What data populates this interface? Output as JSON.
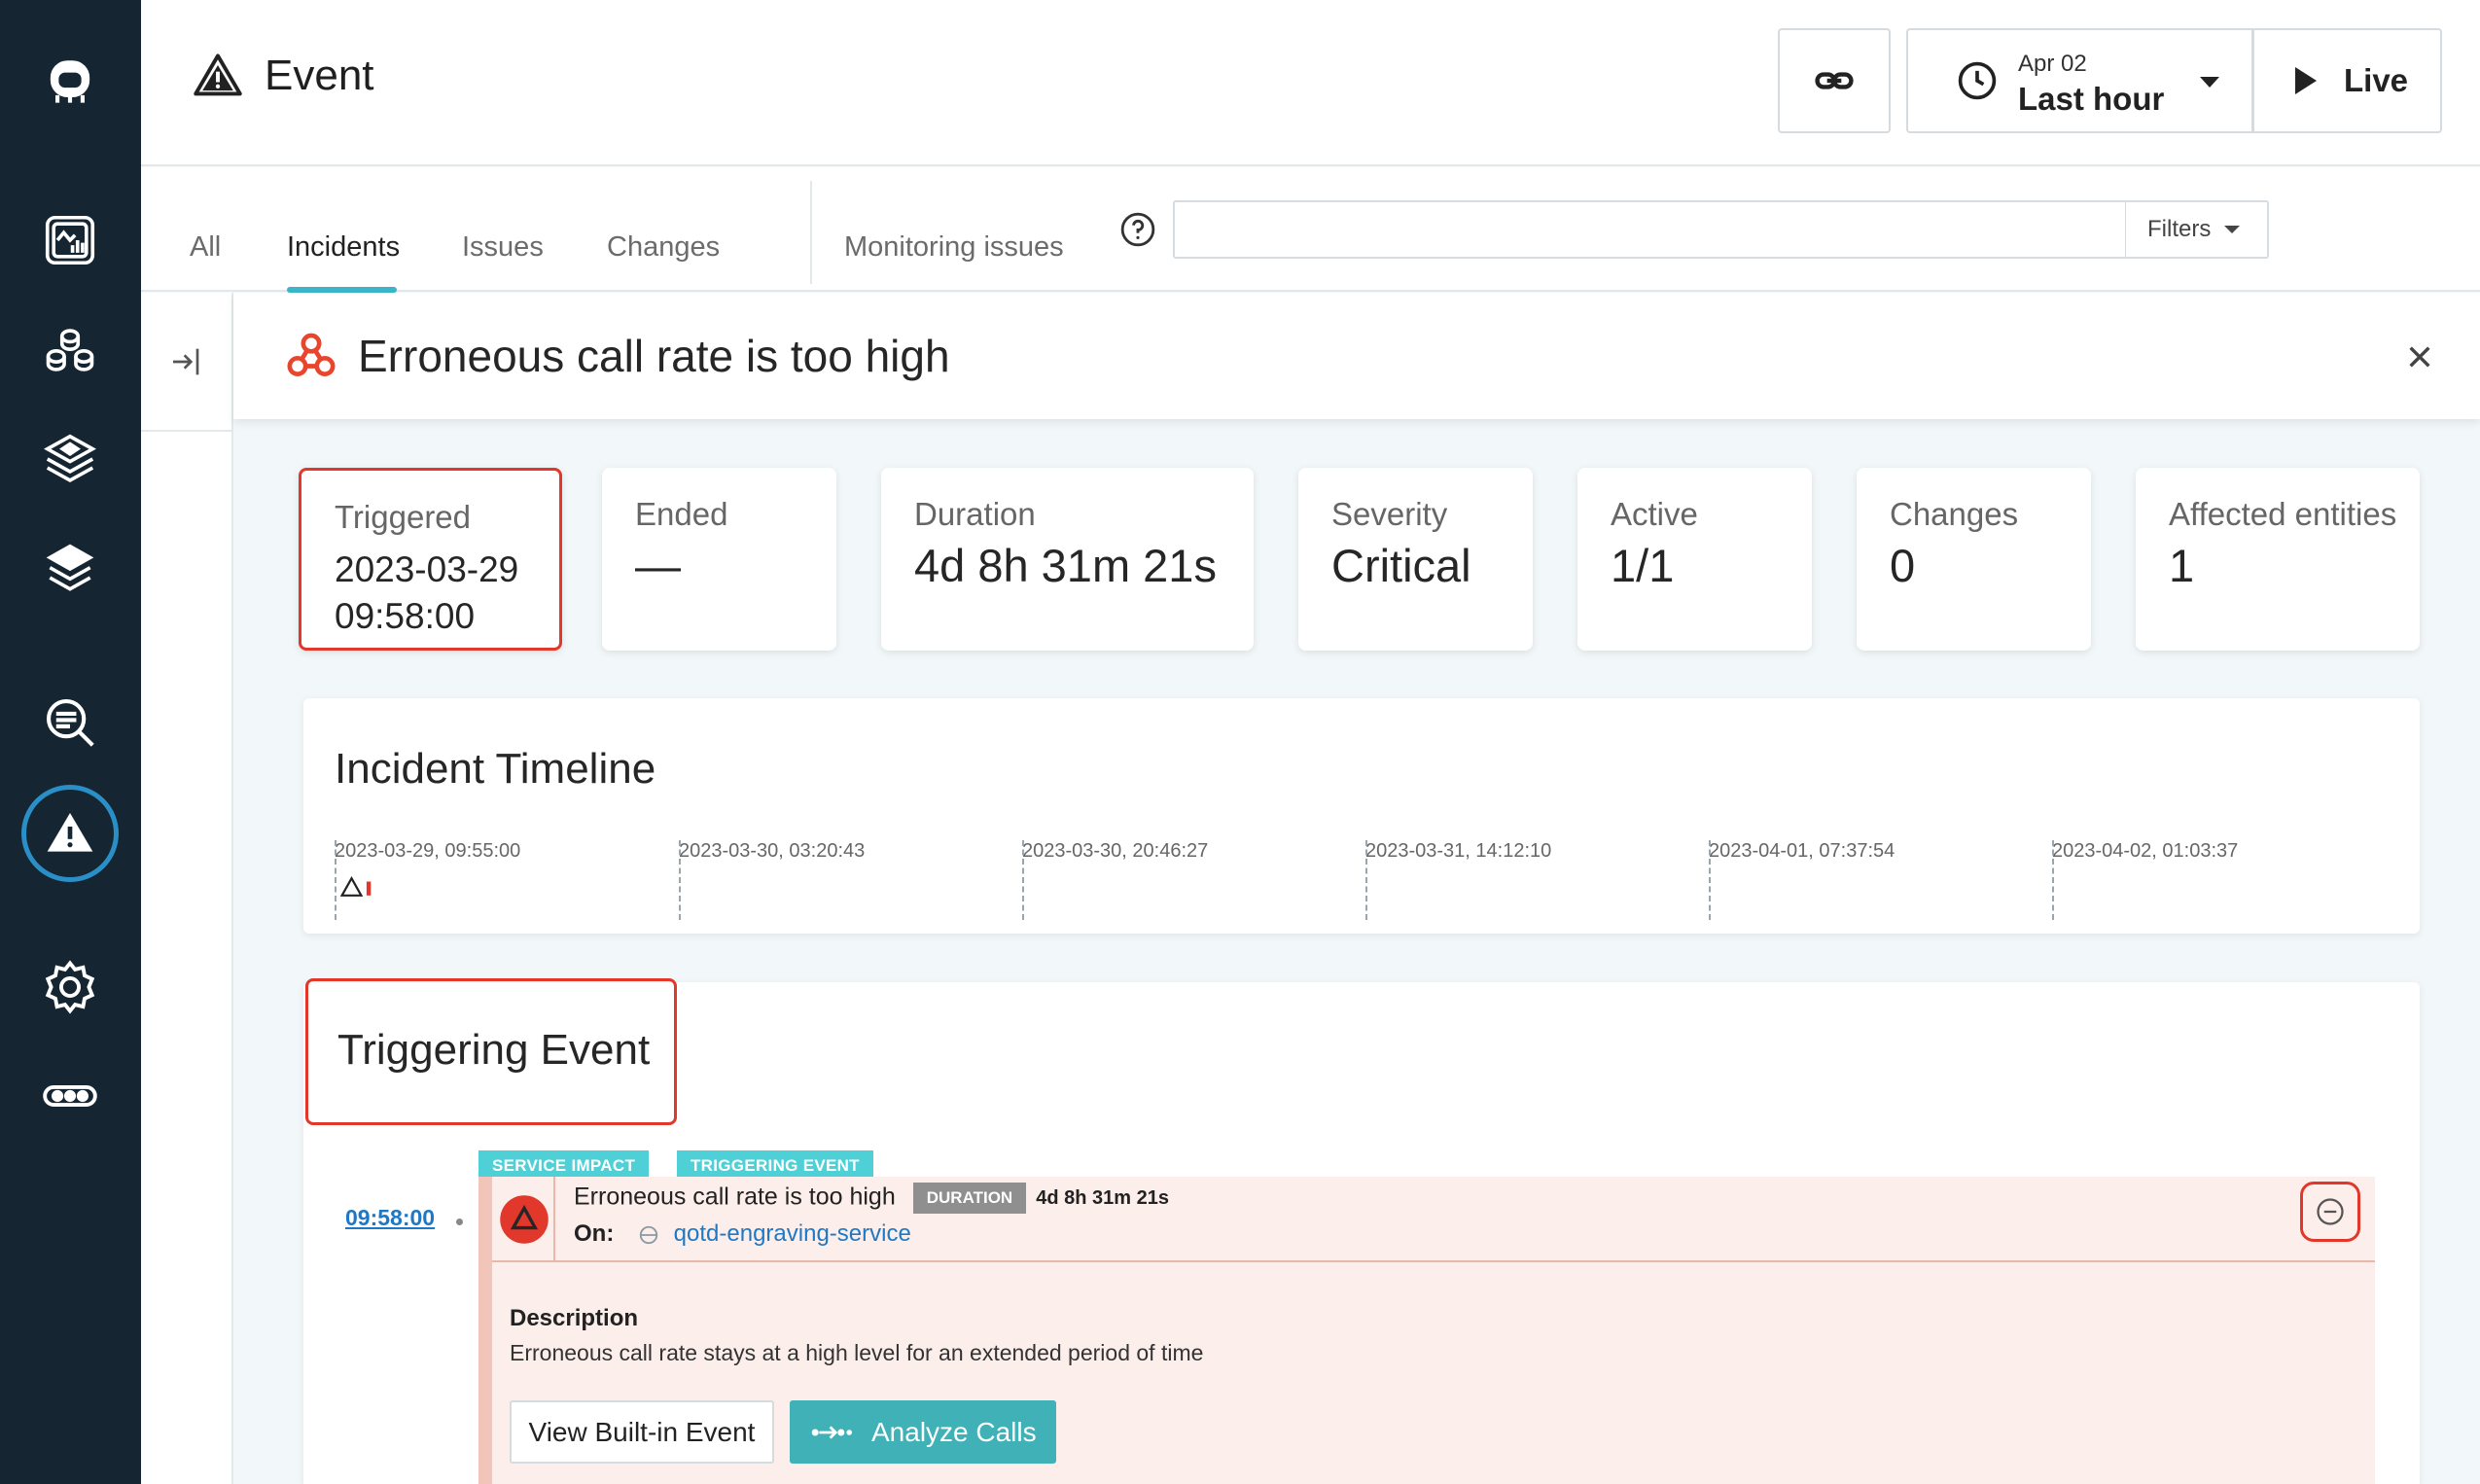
{
  "topbar": {
    "title": "Event",
    "time_date": "Apr 02",
    "time_range": "Last hour",
    "live_label": "Live"
  },
  "tabs": [
    "All",
    "Incidents",
    "Issues",
    "Changes",
    "Monitoring issues"
  ],
  "search": {
    "value": "",
    "placeholder": ""
  },
  "filters_label": "Filters",
  "incident": {
    "title": "Erroneous call rate is too high"
  },
  "cards": [
    {
      "label": "Triggered",
      "value_line1": "2023-03-29",
      "value_line2": "09:58:00"
    },
    {
      "label": "Ended",
      "value": "—"
    },
    {
      "label": "Duration",
      "value": "4d 8h 31m 21s"
    },
    {
      "label": "Severity",
      "value": "Critical"
    },
    {
      "label": "Active",
      "value": "1/1"
    },
    {
      "label": "Changes",
      "value": "0"
    },
    {
      "label": "Affected entities",
      "value": "1"
    }
  ],
  "timeline": {
    "title": "Incident Timeline",
    "ticks": [
      "2023-03-29, 09:55:00",
      "2023-03-30, 03:20:43",
      "2023-03-30, 20:46:27",
      "2023-03-31, 14:12:10",
      "2023-04-01, 07:37:54",
      "2023-04-02, 01:03:37"
    ]
  },
  "triggering": {
    "title": "Triggering Event",
    "time": "09:58:00",
    "badges": [
      "SERVICE IMPACT",
      "TRIGGERING EVENT"
    ],
    "event_title": "Erroneous call rate is too high",
    "duration_badge": "DURATION",
    "duration_value": "4d 8h 31m 21s",
    "on_label": "On:",
    "service": "qotd-engraving-service",
    "description_label": "Description",
    "description": "Erroneous call rate stays at a high level for an extended period of time",
    "btn_view": "View Built-in Event",
    "btn_analyze": "Analyze Calls"
  },
  "colors": {
    "sidebar": "#152532",
    "accent": "#3ab5c9",
    "critical": "#e2382c",
    "teal_button": "#3fb1b7"
  }
}
